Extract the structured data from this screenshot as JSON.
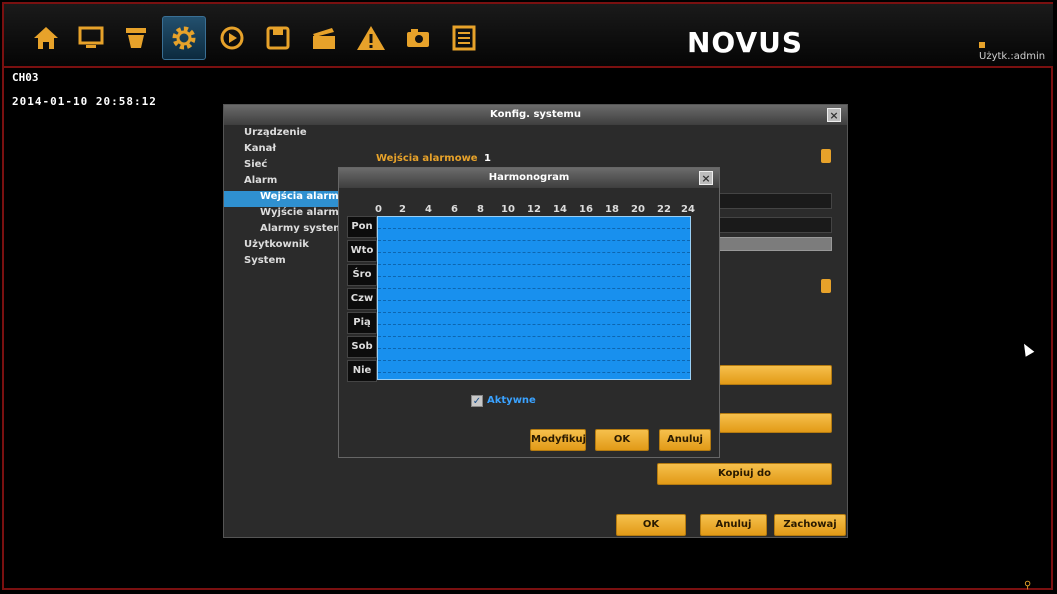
{
  "toolbar": {
    "icons": [
      "home-icon",
      "monitor-icon",
      "camera-icon",
      "gear-icon",
      "play-icon",
      "save-icon",
      "clapperboard-icon",
      "warning-icon",
      "photo-icon",
      "list-icon"
    ],
    "active": "gear-icon"
  },
  "brand": {
    "logo": "NOVUS"
  },
  "user": {
    "label": "Użytk.:admin"
  },
  "camera": {
    "channel": "CH03",
    "datetime": "2014-01-10  20:58:12"
  },
  "main_window": {
    "title": "Konfig. systemu",
    "close": "×",
    "tree": [
      {
        "label": "Urządzenie",
        "level": 0
      },
      {
        "label": "Kanał",
        "level": 0
      },
      {
        "label": "Sieć",
        "level": 0
      },
      {
        "label": "Alarm",
        "level": 0
      },
      {
        "label": "Wejścia alarmowe",
        "level": 1,
        "selected": true
      },
      {
        "label": "Wyjście alarmowe",
        "level": 1
      },
      {
        "label": "Alarmy systemowe",
        "level": 1
      },
      {
        "label": "Użytkownik",
        "level": 0
      },
      {
        "label": "System",
        "level": 0
      }
    ],
    "alarm_input_label": "Wejścia alarmowe",
    "alarm_input_value": "1",
    "copy_button": "Kopiuj do",
    "ok_button": "OK",
    "cancel_button": "Anuluj",
    "save_button": "Zachowaj"
  },
  "schedule_window": {
    "title": "Harmonogram",
    "close": "×",
    "hours": [
      "0",
      "2",
      "4",
      "6",
      "8",
      "10",
      "12",
      "14",
      "16",
      "18",
      "20",
      "22",
      "24"
    ],
    "days": [
      "Pon",
      "Wto",
      "Śro",
      "Czw",
      "Pią",
      "Sob",
      "Nie"
    ],
    "active_label": "Aktywne",
    "active_checked": true,
    "modify_button": "Modyfikuj",
    "ok_button": "OK",
    "cancel_button": "Anuluj"
  },
  "colors": {
    "accent": "#e7a22a",
    "grid": "#1890ee",
    "selection": "#2f90d0",
    "frame": "#7a1010"
  }
}
